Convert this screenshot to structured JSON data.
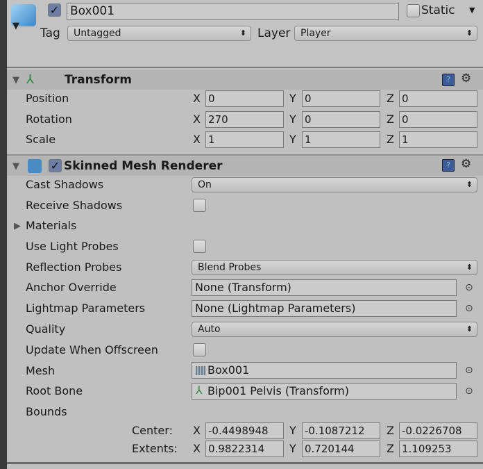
{
  "object": {
    "name": "Box001",
    "active": true,
    "static_label": "Static",
    "static": false,
    "tag_label": "Tag",
    "tag": "Untagged",
    "layer_label": "Layer",
    "layer": "Player"
  },
  "transform": {
    "title": "Transform",
    "rows": [
      {
        "label": "Position",
        "x": "0",
        "y": "0",
        "z": "0"
      },
      {
        "label": "Rotation",
        "x": "270",
        "y": "0",
        "z": "0"
      },
      {
        "label": "Scale",
        "x": "1",
        "y": "1",
        "z": "1"
      }
    ]
  },
  "axes": {
    "x": "X",
    "y": "Y",
    "z": "Z"
  },
  "smr": {
    "title": "Skinned Mesh Renderer",
    "enabled": true,
    "cast_shadows": {
      "label": "Cast Shadows",
      "value": "On"
    },
    "receive_shadows": {
      "label": "Receive Shadows",
      "checked": false
    },
    "materials": {
      "label": "Materials"
    },
    "use_light_probes": {
      "label": "Use Light Probes",
      "checked": false
    },
    "reflection_probes": {
      "label": "Reflection Probes",
      "value": "Blend Probes"
    },
    "anchor_override": {
      "label": "Anchor Override",
      "value": "None (Transform)"
    },
    "lightmap_parameters": {
      "label": "Lightmap Parameters",
      "value": "None (Lightmap Parameters)"
    },
    "quality": {
      "label": "Quality",
      "value": "Auto"
    },
    "update_offscreen": {
      "label": "Update When Offscreen",
      "checked": false
    },
    "mesh": {
      "label": "Mesh",
      "value": "Box001"
    },
    "root_bone": {
      "label": "Root Bone",
      "value": "Bip001 Pelvis (Transform)"
    },
    "bounds": {
      "label": "Bounds",
      "center": {
        "label": "Center:",
        "x": "-0.4498948",
        "y": "-0.1087212",
        "z": "-0.0226708"
      },
      "extents": {
        "label": "Extents:",
        "x": "0.9822314",
        "y": "0.720144",
        "z": "1.109253"
      }
    }
  },
  "colors": {
    "checkbox": "#6c7da6",
    "help": "#3a5d9a"
  }
}
